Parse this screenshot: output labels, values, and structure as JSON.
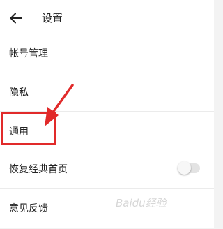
{
  "header": {
    "back_icon": "arrow-left-icon",
    "title": "设置"
  },
  "settings": {
    "account": "帐号管理",
    "privacy": "隐私",
    "general": "通用",
    "restore_home": {
      "label": "恢复经典首页",
      "toggle_on": false
    },
    "feedback": "意见反馈"
  },
  "annotation": {
    "color": "#e12a2a"
  },
  "watermark": "Baidu经验"
}
